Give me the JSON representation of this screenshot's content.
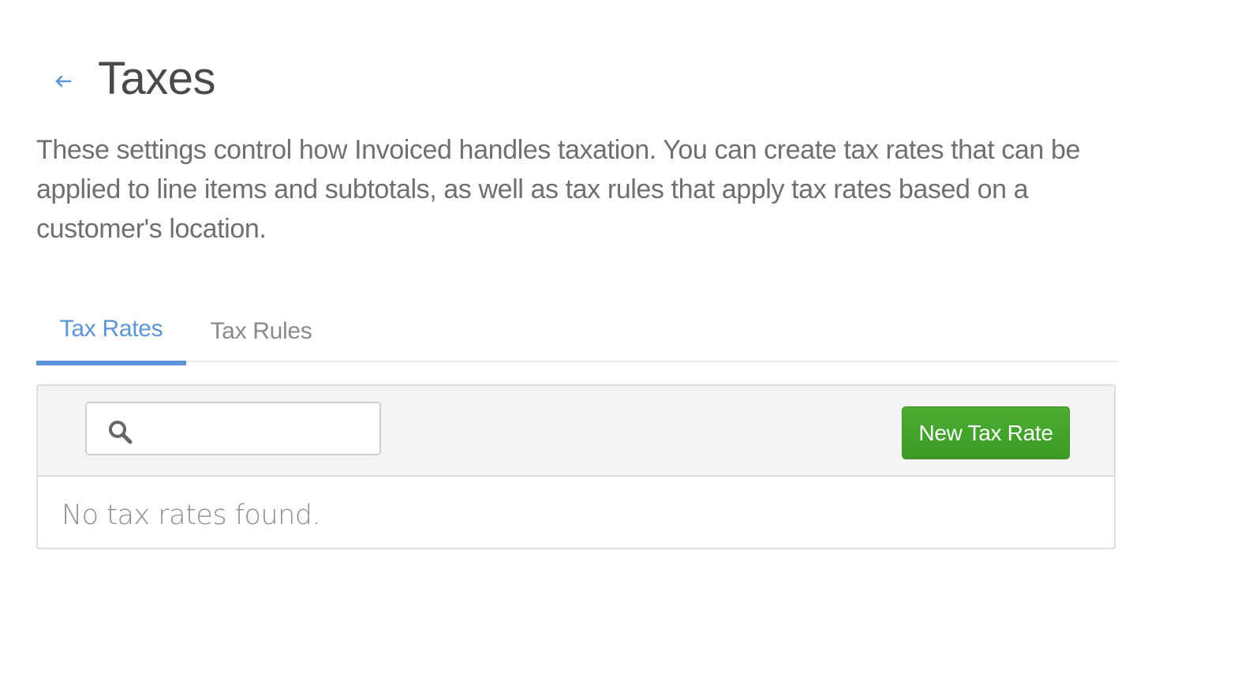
{
  "header": {
    "back_icon": "arrow-left-icon",
    "title": "Taxes"
  },
  "description": "These settings control how Invoiced handles taxation. You can create tax rates that can be applied to line items and subtotals, as well as tax rules that apply tax rates based on a customer's location.",
  "tabs": [
    {
      "label": "Tax Rates",
      "active": true
    },
    {
      "label": "Tax Rules",
      "active": false
    }
  ],
  "toolbar": {
    "search_icon": "search-icon",
    "search_value": "",
    "search_placeholder": "",
    "new_button_label": "New Tax Rate"
  },
  "list": {
    "empty_message": "No tax rates found."
  },
  "colors": {
    "accent": "#5b95d6",
    "primary_button": "#45a52d",
    "text_muted": "#6f6f6f"
  }
}
